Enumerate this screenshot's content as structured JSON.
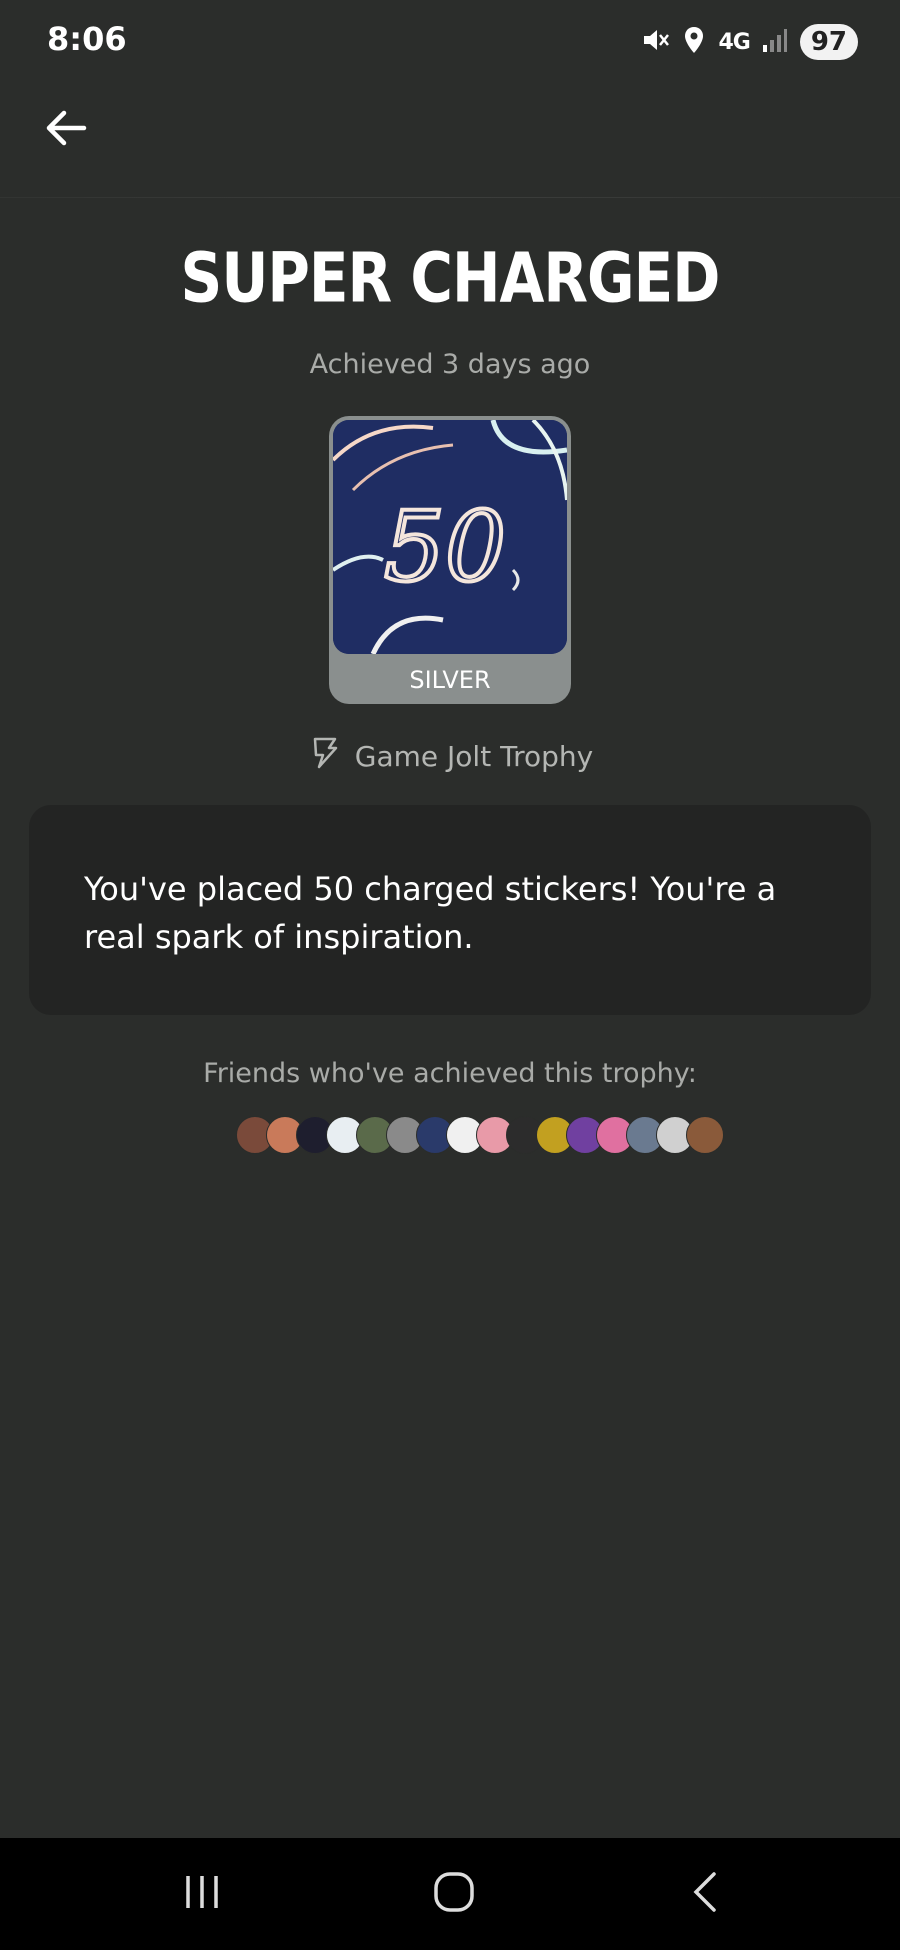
{
  "status_bar": {
    "time": "8:06",
    "network": "4G",
    "battery": "97",
    "icons": [
      "mute-icon",
      "location-icon",
      "signal-icon"
    ]
  },
  "header": {
    "back_icon": "arrow-left-icon"
  },
  "trophy": {
    "title": "SUPER CHARGED",
    "achieved": "Achieved 3 days ago",
    "level": "SILVER",
    "image_text": "50",
    "type_icon": "lightning-icon",
    "type": "Game Jolt Trophy",
    "description": "You've placed 50 charged stickers! You're a real spark of inspiration."
  },
  "friends": {
    "label": "Friends who've achieved this trophy:",
    "avatar_colors": [
      "#7a4a3a",
      "#c97a5a",
      "#1e1e2e",
      "#e8eef2",
      "#5a6a4a",
      "#8a8a8a",
      "#2a3a6a",
      "#f0f0f0",
      "#e89aa8",
      "#2c2c2c",
      "#c2a020",
      "#7040a0",
      "#e070a0",
      "#6a7a90",
      "#d0d0d0",
      "#8a5a3a"
    ]
  },
  "nav_bar": {
    "icons": [
      "recent-apps-icon",
      "home-icon",
      "back-icon"
    ]
  }
}
